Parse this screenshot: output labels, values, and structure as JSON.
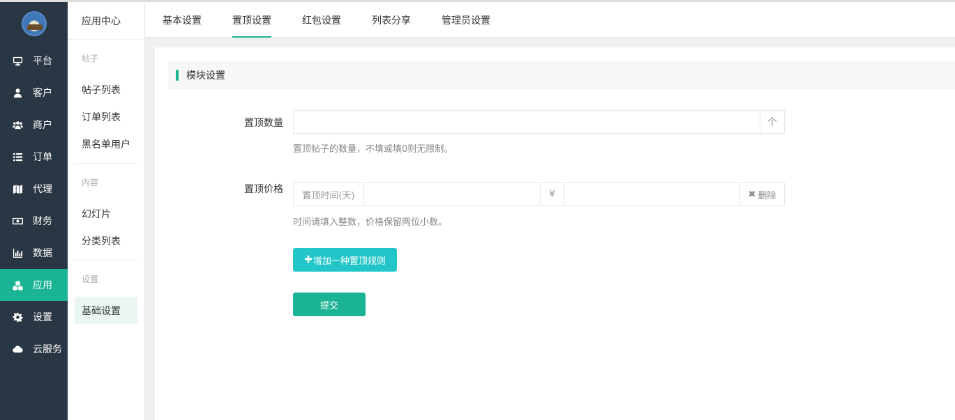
{
  "nav": {
    "items": [
      {
        "label": "平台",
        "icon": "monitor-icon"
      },
      {
        "label": "客户",
        "icon": "user-icon"
      },
      {
        "label": "商户",
        "icon": "users-icon"
      },
      {
        "label": "订单",
        "icon": "list-icon"
      },
      {
        "label": "代理",
        "icon": "map-icon"
      },
      {
        "label": "财务",
        "icon": "money-icon"
      },
      {
        "label": "数据",
        "icon": "bar-chart-icon"
      },
      {
        "label": "应用",
        "icon": "cubes-icon",
        "active": true
      },
      {
        "label": "设置",
        "icon": "gear-icon"
      },
      {
        "label": "云服务",
        "icon": "cloud-icon"
      }
    ]
  },
  "subnav": {
    "title": "应用中心",
    "groups": [
      {
        "title": "帖子",
        "items": [
          "帖子列表",
          "订单列表",
          "黑名单用户"
        ]
      },
      {
        "title": "内容",
        "items": [
          "幻灯片",
          "分类列表"
        ]
      },
      {
        "title": "设置",
        "items": [
          "基础设置"
        ]
      }
    ]
  },
  "tabs": [
    "基本设置",
    "置顶设置",
    "红包设置",
    "列表分享",
    "管理员设置"
  ],
  "section": {
    "title": "模块设置"
  },
  "form": {
    "top_count": {
      "label": "置顶数量",
      "value": "",
      "addon": "个",
      "help": "置顶帖子的数量，不填或填0则无限制。"
    },
    "top_price": {
      "label": "置顶价格",
      "time_placeholder": "置顶时间(天)",
      "currency": "¥",
      "delete_label": "删除",
      "help": "时间请填入整数，价格保留两位小数。"
    },
    "add_rule_label": "增加一种置顶规则",
    "submit_label": "提交"
  },
  "colors": {
    "accent": "#1ab394",
    "nav_bg": "#293643",
    "info": "#23c6c8"
  }
}
